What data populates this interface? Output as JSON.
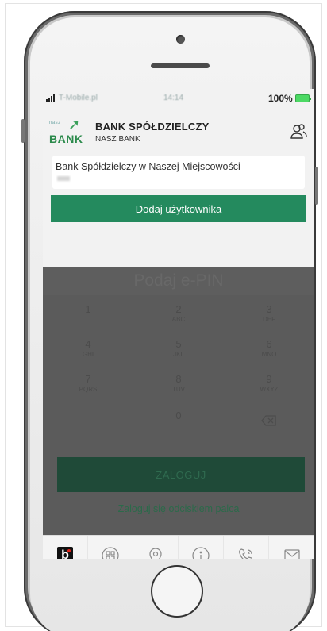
{
  "status_bar": {
    "carrier": "T-Mobile.pl",
    "time": "14:14",
    "battery": "100%"
  },
  "header": {
    "logo_small": "nasz",
    "logo_text": "BANK",
    "bank_name": "BANK SPÓŁDZIELCZY",
    "bank_sub": "NASZ BANK"
  },
  "account": {
    "name": "Bank Spółdzielczy w Naszej Miejscowości"
  },
  "add_user_label": "Dodaj użytkownika",
  "pin": {
    "title": "Podaj e-PIN",
    "keys": [
      {
        "digit": "1",
        "letters": ""
      },
      {
        "digit": "2",
        "letters": "ABC"
      },
      {
        "digit": "3",
        "letters": "DEF"
      },
      {
        "digit": "4",
        "letters": "GHI"
      },
      {
        "digit": "5",
        "letters": "JKL"
      },
      {
        "digit": "6",
        "letters": "MNO"
      },
      {
        "digit": "7",
        "letters": "PQRS"
      },
      {
        "digit": "8",
        "letters": "TUV"
      },
      {
        "digit": "9",
        "letters": "WXYZ"
      },
      {
        "digit": "0",
        "letters": ""
      }
    ],
    "login_label": "ZALOGUJ",
    "fingerprint_label": "Zaloguj się odciskiem palca"
  },
  "tabs": [
    {
      "icon": "bank-logo-icon"
    },
    {
      "icon": "qr-code-icon"
    },
    {
      "icon": "location-pin-icon"
    },
    {
      "icon": "info-icon"
    },
    {
      "icon": "phone-icon"
    },
    {
      "icon": "envelope-icon"
    }
  ],
  "colors": {
    "accent": "#248a5e",
    "overlay": "#5b5b5b",
    "login_button": "#1f4a38"
  }
}
